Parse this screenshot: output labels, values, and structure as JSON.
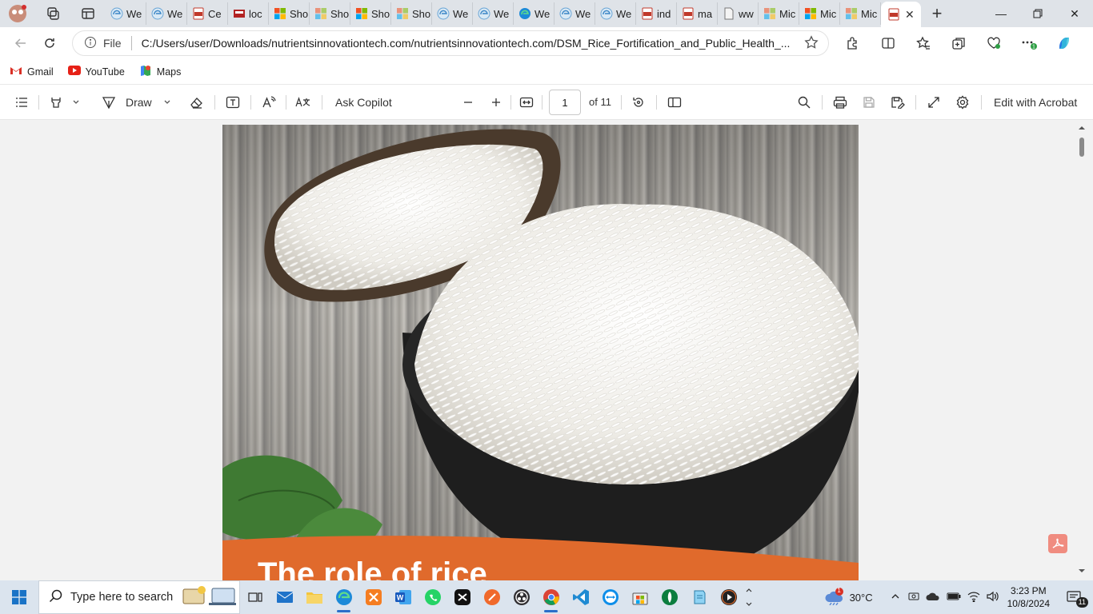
{
  "tabs": [
    {
      "label": "We",
      "icon": "edge-page-icon"
    },
    {
      "label": "We",
      "icon": "edge-page-icon"
    },
    {
      "label": "Ce",
      "icon": "pdf-file-icon"
    },
    {
      "label": "loc",
      "icon": "site-logo-icon"
    },
    {
      "label": "Sho",
      "icon": "microsoft-logo-icon"
    },
    {
      "label": "Sho",
      "icon": "microsoft-faded-icon"
    },
    {
      "label": "Sho",
      "icon": "microsoft-logo-icon"
    },
    {
      "label": "Sho",
      "icon": "microsoft-faded-icon"
    },
    {
      "label": "We",
      "icon": "edge-page-icon"
    },
    {
      "label": "We",
      "icon": "edge-page-icon"
    },
    {
      "label": "We",
      "icon": "edge-logo-icon"
    },
    {
      "label": "We",
      "icon": "edge-page-icon"
    },
    {
      "label": "We",
      "icon": "edge-page-icon"
    },
    {
      "label": "ind",
      "icon": "pdf-file-icon"
    },
    {
      "label": "ma",
      "icon": "pdf-file-icon"
    },
    {
      "label": "ww",
      "icon": "generic-file-icon"
    },
    {
      "label": "Mic",
      "icon": "microsoft-faded-icon"
    },
    {
      "label": "Mic",
      "icon": "microsoft-logo-icon"
    },
    {
      "label": "Mic",
      "icon": "microsoft-faded-icon"
    }
  ],
  "active_tab": {
    "icon": "pdf-file-icon"
  },
  "address": {
    "scheme_label": "File",
    "url": "C:/Users/user/Downloads/nutrientsinnovationtech.com/nutrientsinnovationtech.com/DSM_Rice_Fortification_and_Public_Health_..."
  },
  "bookmarks": [
    {
      "label": "Gmail",
      "icon": "gmail-icon"
    },
    {
      "label": "YouTube",
      "icon": "youtube-icon"
    },
    {
      "label": "Maps",
      "icon": "maps-icon"
    }
  ],
  "pdf_toolbar": {
    "draw_label": "Draw",
    "ask_copilot_label": "Ask Copilot",
    "page_current": "1",
    "page_total": "of 11",
    "edit_acrobat_label": "Edit with Acrobat"
  },
  "pdf_page": {
    "heading": "The role of rice",
    "colors": {
      "banner": "#e06a2c",
      "bowl": "#1e1e1e",
      "rice": "#f4f2ec"
    }
  },
  "taskbar": {
    "search_placeholder": "Type here to search",
    "weather": "30°C",
    "weather_badge": "1",
    "time": "3:23 PM",
    "date": "10/8/2024",
    "notification_count": "11"
  }
}
